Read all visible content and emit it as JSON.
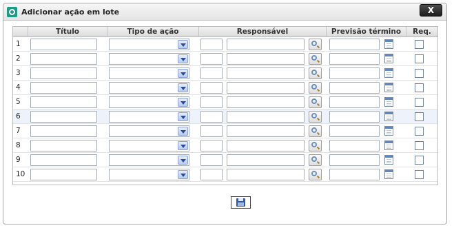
{
  "dialog": {
    "title": "Adicionar ação em lote",
    "close_label": "X"
  },
  "table": {
    "headers": [
      "Título",
      "Tipo de ação",
      "Responsável",
      "Previsão término",
      "Req."
    ],
    "rows": [
      {
        "number": "1"
      },
      {
        "number": "2"
      },
      {
        "number": "3"
      },
      {
        "number": "4"
      },
      {
        "number": "5"
      },
      {
        "number": "6"
      },
      {
        "number": "7"
      },
      {
        "number": "8"
      },
      {
        "number": "9"
      },
      {
        "number": "10"
      }
    ],
    "highlighted_row": "6"
  },
  "icons": {
    "app": "app-logo-icon",
    "lookup": "search-icon",
    "date": "calendar-icon",
    "save": "save-disk-icon"
  },
  "colors": {
    "accent": "#1f9a8a",
    "row_highlight": "#eef3fb",
    "select_arrow": "#2a4c9a"
  }
}
